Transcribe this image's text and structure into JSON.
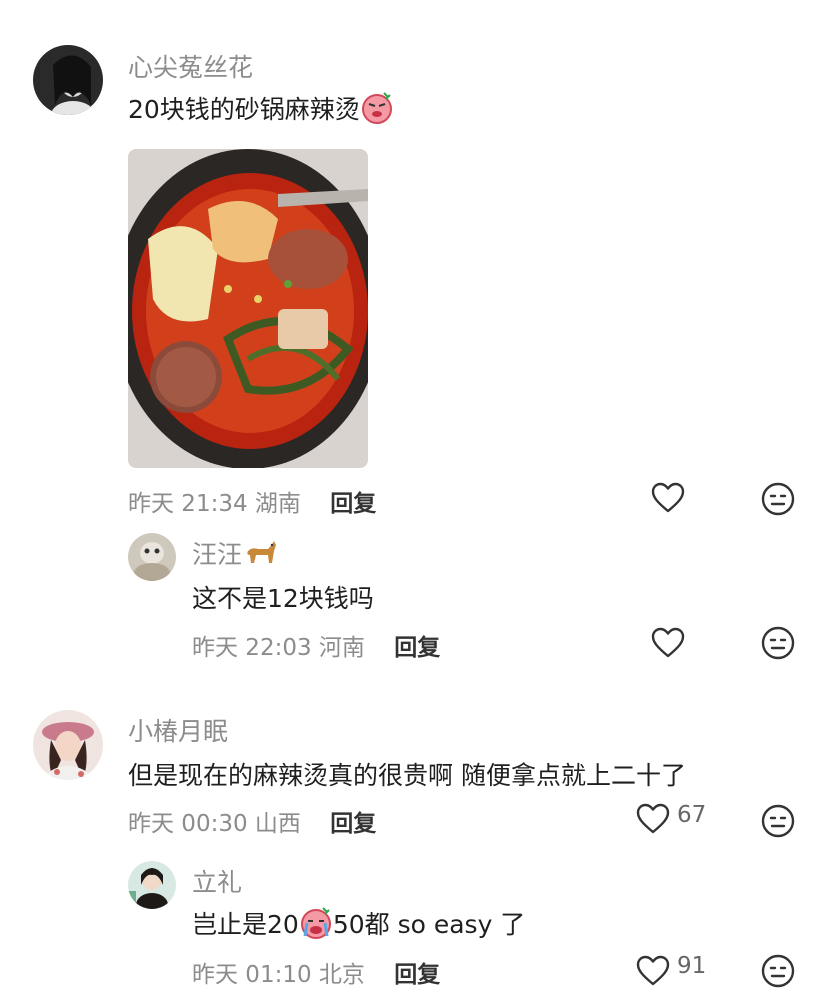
{
  "comments": [
    {
      "username": "心尖菟丝花",
      "text": "20块钱的砂锅麻辣烫",
      "text_emoji": "angry-face-emoji",
      "image_alt": "麻辣烫",
      "time": "昨天 21:34",
      "location": "湖南",
      "reply_label": "回复",
      "like_count": "",
      "replies": [
        {
          "username": "汪汪",
          "name_emoji": "dog-emoji",
          "text": "这不是12块钱吗",
          "time": "昨天 22:03",
          "location": "河南",
          "reply_label": "回复",
          "like_count": ""
        }
      ]
    },
    {
      "username": "小椿月眠",
      "text": "但是现在的麻辣烫真的很贵啊 随便拿点就上二十了",
      "time": "昨天 00:30",
      "location": "山西",
      "reply_label": "回复",
      "like_count": "67",
      "replies": [
        {
          "username": "立礼",
          "text_before": "岂止是20",
          "text_emoji": "crying-face-emoji",
          "text_after": "50都 so easy 了",
          "time": "昨天 01:10",
          "location": "北京",
          "reply_label": "回复",
          "like_count": "91"
        }
      ]
    }
  ],
  "icons": {
    "like": "heart-outline-icon",
    "dislike": "neutral-face-icon"
  },
  "colors": {
    "name": "#8c8c8c",
    "meta": "#8c8c8c",
    "text": "#1f1f1f",
    "icon": "#333333"
  }
}
